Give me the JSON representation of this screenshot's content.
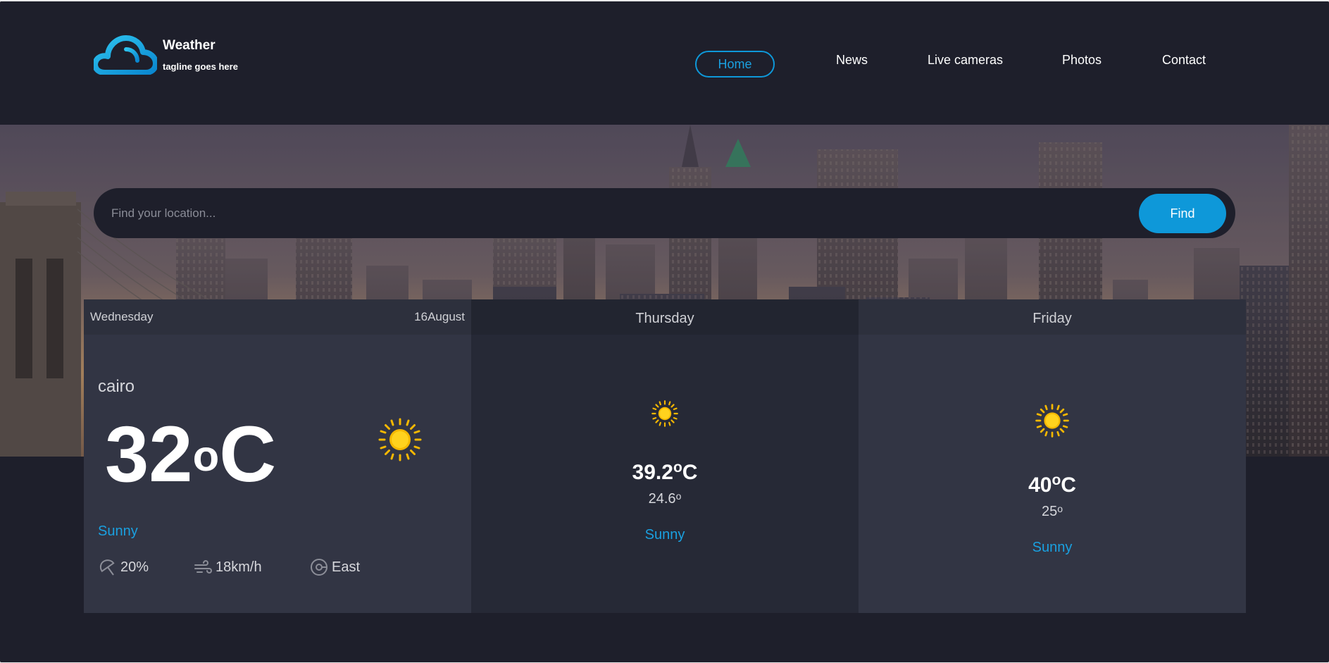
{
  "brand": {
    "title": "Weather",
    "tagline": "tagline goes here"
  },
  "nav": {
    "items": [
      "Home",
      "News",
      "Live cameras",
      "Photos",
      "Contact"
    ],
    "active": "Home"
  },
  "search": {
    "placeholder": "Find your location...",
    "button_label": "Find"
  },
  "today": {
    "weekday": "Wednesday",
    "date": "16August",
    "location": "cairo",
    "temp_value": "32",
    "temp_unit": "o",
    "temp_scale": "C",
    "condition": "Sunny",
    "metrics": {
      "rain": "20%",
      "wind_speed": "18km/h",
      "wind_direction": "East"
    },
    "icon": "sun-icon"
  },
  "forecast": [
    {
      "day": "Thursday",
      "high_value": "39.2",
      "high_unit": "o",
      "high_scale": "C",
      "low_value": "24.6",
      "low_unit": "o",
      "condition": "Sunny",
      "icon": "sun-icon"
    },
    {
      "day": "Friday",
      "high_value": "40",
      "high_unit": "o",
      "high_scale": "C",
      "low_value": "25",
      "low_unit": "o",
      "condition": "Sunny",
      "icon": "sun-icon"
    }
  ],
  "colors": {
    "accent": "#0e98d9",
    "background": "#1e1f2b",
    "card": "#323544",
    "card_alt": "#262936",
    "condition_text": "#1aa0e0"
  }
}
